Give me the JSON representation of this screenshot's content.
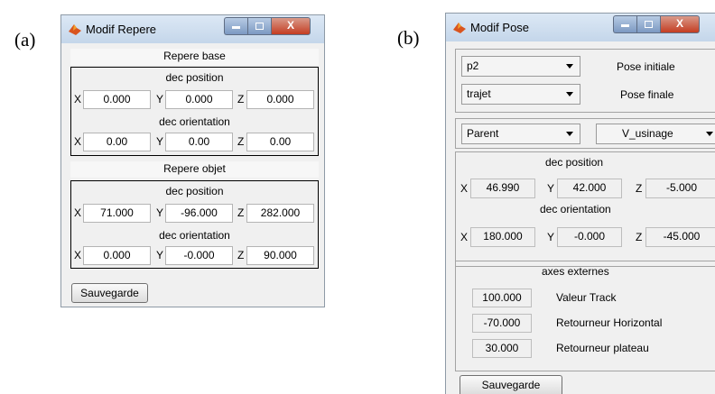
{
  "labels": {
    "a": "(a)",
    "b": "(b)"
  },
  "colors": {
    "window_bg": "#f0f0f0",
    "titlebar": "#c4d6ea",
    "close_button": "#c43d22"
  },
  "icons": {
    "app": "matlab-icon",
    "minimize": "minimize-icon",
    "maximize": "maximize-icon",
    "close": "close-icon",
    "dropdown": "chevron-down-icon"
  },
  "repere": {
    "title": "Modif Repere",
    "close_glyph": "X",
    "base": {
      "header": "Repere base",
      "position_label": "dec position",
      "position": {
        "x_label": "X",
        "y_label": "Y",
        "z_label": "Z",
        "x": "0.000",
        "y": "0.000",
        "z": "0.000"
      },
      "orientation_label": "dec orientation",
      "orientation": {
        "x_label": "X",
        "y_label": "Y",
        "z_label": "Z",
        "x": "0.00",
        "y": "0.00",
        "z": "0.00"
      }
    },
    "objet": {
      "header": "Repere objet",
      "position_label": "dec position",
      "position": {
        "x_label": "X",
        "y_label": "Y",
        "z_label": "Z",
        "x": "71.000",
        "y": "-96.000",
        "z": "282.000"
      },
      "orientation_label": "dec orientation",
      "orientation": {
        "x_label": "X",
        "y_label": "Y",
        "z_label": "Z",
        "x": "0.000",
        "y": "-0.000",
        "z": "90.000"
      }
    },
    "save_label": "Sauvegarde"
  },
  "pose": {
    "title": "Modif Pose",
    "close_glyph": "X",
    "pose_initiale": {
      "value": "p2",
      "label": "Pose initiale"
    },
    "pose_finale": {
      "value": "trajet",
      "label": "Pose finale"
    },
    "parent": {
      "value": "Parent"
    },
    "repere": {
      "value": "V_usinage"
    },
    "position_label": "dec position",
    "position": {
      "x_label": "X",
      "y_label": "Y",
      "z_label": "Z",
      "x": "46.990",
      "y": "42.000",
      "z": "-5.000"
    },
    "orientation_label": "dec orientation",
    "orientation": {
      "x_label": "X",
      "y_label": "Y",
      "z_label": "Z",
      "x": "180.000",
      "y": "-0.000",
      "z": "-45.000"
    },
    "axes": {
      "header": "axes externes",
      "track": {
        "value": "100.000",
        "label": "Valeur Track"
      },
      "horizontal": {
        "value": "-70.000",
        "label": "Retourneur Horizontal"
      },
      "plateau": {
        "value": "30.000",
        "label": "Retourneur plateau"
      }
    },
    "save_label": "Sauvegarde"
  }
}
